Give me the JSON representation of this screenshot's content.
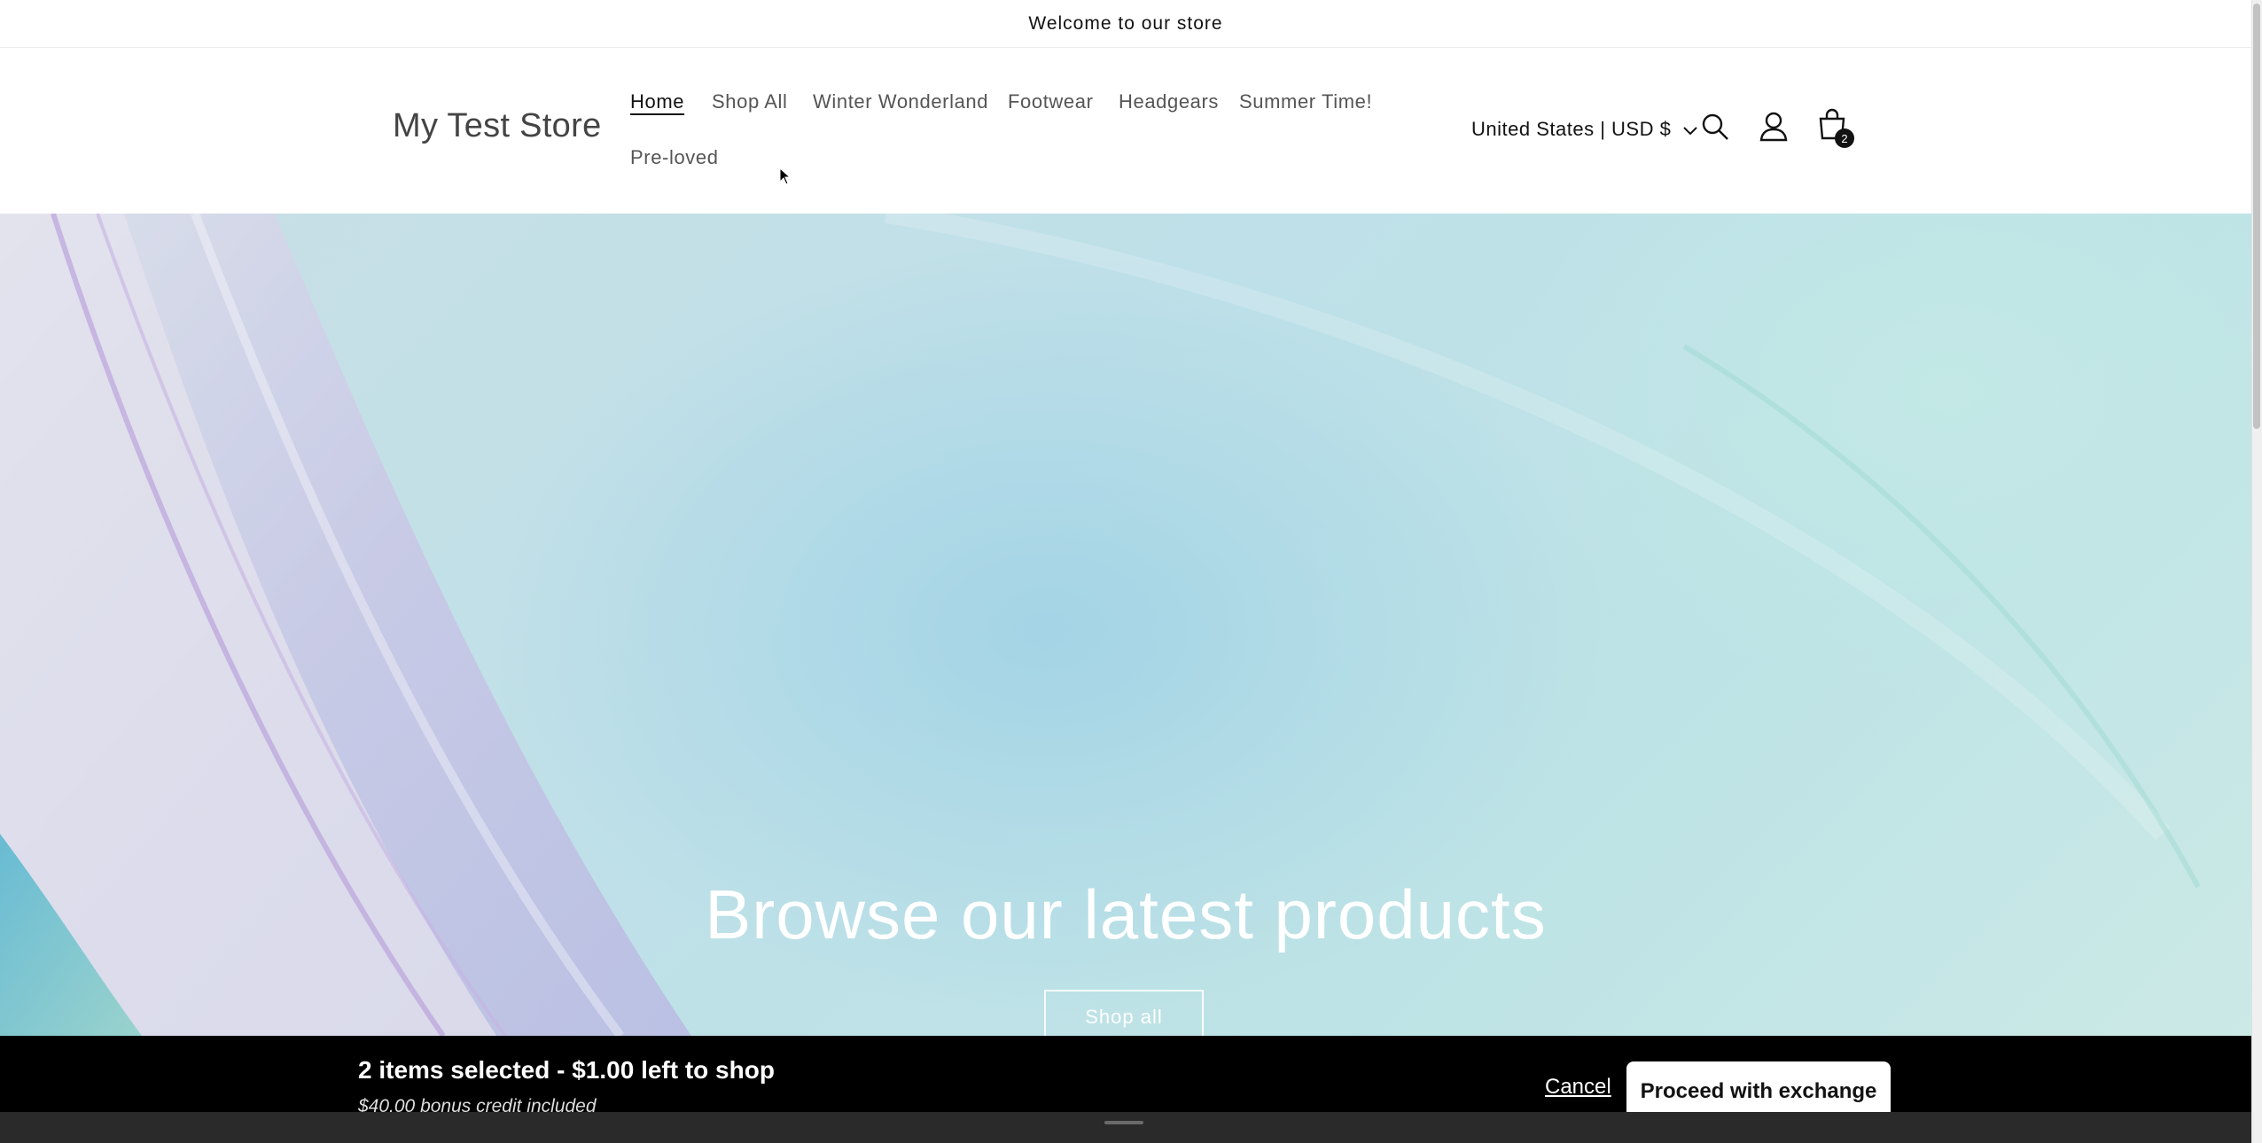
{
  "announcement": {
    "text": "Welcome to our store"
  },
  "header": {
    "logo": "My Test Store",
    "nav": [
      {
        "label": "Home",
        "active": true
      },
      {
        "label": "Shop All"
      },
      {
        "label": "Winter Wonderland"
      },
      {
        "label": "Footwear"
      },
      {
        "label": "Headgears"
      },
      {
        "label": "Summer Time!"
      },
      {
        "label": "Pre-loved"
      }
    ],
    "country_selector": "United States | USD $",
    "icons": [
      "search-icon",
      "account-icon",
      "cart-icon"
    ],
    "cart_count": "2"
  },
  "hero": {
    "title": "Browse our latest products",
    "button_label": "Shop all"
  },
  "exchange_bar": {
    "title": "2 items selected - $1.00 left to shop",
    "subtitle": "$40.00 bonus credit included",
    "cancel_label": "Cancel",
    "proceed_label": "Proceed with exchange",
    "background_color": "#000000"
  }
}
